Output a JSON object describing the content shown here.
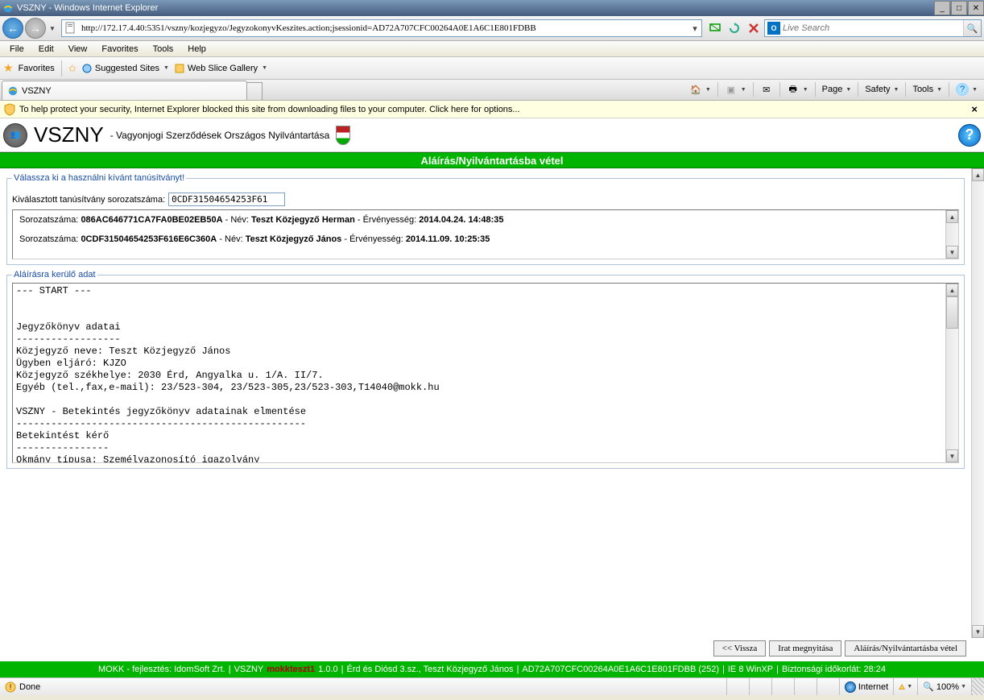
{
  "window": {
    "title": "VSZNY - Windows Internet Explorer"
  },
  "nav": {
    "url": "http://172.17.4.40:5351/vszny/kozjegyzo/JegyzokonyvKeszites.action;jsessionid=AD72A707CFC00264A0E1A6C1E801FDBB",
    "search_placeholder": "Live Search"
  },
  "menu": {
    "file": "File",
    "edit": "Edit",
    "view": "View",
    "favorites": "Favorites",
    "tools": "Tools",
    "help": "Help"
  },
  "favbar": {
    "label": "Favorites",
    "suggested": "Suggested Sites",
    "webslice": "Web Slice Gallery"
  },
  "tab": {
    "title": "VSZNY"
  },
  "cmd": {
    "page": "Page",
    "safety": "Safety",
    "tools": "Tools"
  },
  "infobar": {
    "text": "To help protect your security, Internet Explorer blocked this site from downloading files to your computer. Click here for options..."
  },
  "app": {
    "title": "VSZNY",
    "subtitle": "- Vagyonjogi Szerződések Országos Nyilvántartása",
    "greenbar": "Aláírás/Nyilvántartásba vétel"
  },
  "cert": {
    "legend": "Válassza ki a használni kívánt tanúsítványt!",
    "label": "Kiválasztott tanúsítvány sorozatszáma:",
    "value": "0CDF31504654253F61",
    "rows": [
      {
        "sn_lbl": "Sorozatszáma:",
        "sn": "086AC646771CA7FA0BE02EB50A",
        "nev_lbl": "- Név:",
        "nev": "Teszt Közjegyző Herman",
        "erv_lbl": "- Érvényesség:",
        "erv": "2014.04.24. 14:48:35"
      },
      {
        "sn_lbl": "Sorozatszáma:",
        "sn": "0CDF31504654253F616E6C360A",
        "nev_lbl": "- Név:",
        "nev": "Teszt Közjegyző János",
        "erv_lbl": "- Érvényesség:",
        "erv": "2014.11.09. 10:25:35"
      }
    ]
  },
  "sign": {
    "legend": "Aláírásra kerülő adat",
    "text": "--- START ---\n\n\nJegyzőkönyv adatai\n------------------\nKözjegyző neve: Teszt Közjegyző János\nÜgyben eljáró: KJZO\nKözjegyző székhelye: 2030 Érd, Angyalka u. 1/A. II/7.\nEgyéb (tel.,fax,e-mail): 23/523-304, 23/523-305,23/523-303,T14040@mokk.hu\n\nVSZNY - Betekintés jegyzőkönyv adatainak elmentése\n--------------------------------------------------\nBetekintést kérő\n----------------\nOkmány típusa: Személyazonosító igazolvány"
  },
  "buttons": {
    "back": "<< Vissza",
    "open": "Irat megnyitása",
    "sign": "Aláírás/Nyilvántartásba vétel"
  },
  "footer": {
    "p1": "MOKK - fejlesztés: IdomSoft Zrt.",
    "p2a": "VSZNY",
    "p2b": "mokkteszt1",
    "p2c": "1.0.0",
    "p3": "Érd és Diósd 3.sz., Teszt Közjegyző János",
    "p4": "AD72A707CFC00264A0E1A6C1E801FDBB (252)",
    "p5": "IE 8 WinXP",
    "p6": "Biztonsági időkorlát:  28:24"
  },
  "status": {
    "done": "Done",
    "zone": "Internet",
    "zoom": "100%"
  }
}
